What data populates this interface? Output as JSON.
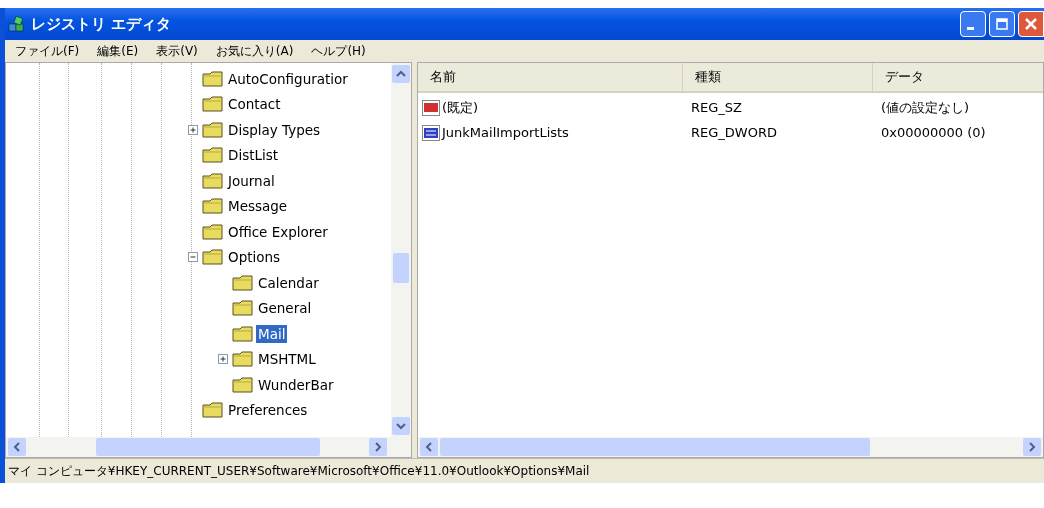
{
  "window": {
    "title": "レジストリ エディタ"
  },
  "menu": [
    {
      "label": "ファイル(F)"
    },
    {
      "label": "編集(E)"
    },
    {
      "label": "表示(V)"
    },
    {
      "label": "お気に入り(A)"
    },
    {
      "label": "ヘルプ(H)"
    }
  ],
  "tree": {
    "items": [
      {
        "label": "AutoConfiguratior",
        "selected": false
      },
      {
        "label": "Contact",
        "selected": false
      },
      {
        "label": "Display Types",
        "selected": false,
        "expanded": false
      },
      {
        "label": "DistList",
        "selected": false
      },
      {
        "label": "Journal",
        "selected": false
      },
      {
        "label": "Message",
        "selected": false
      },
      {
        "label": "Office Explorer",
        "selected": false
      },
      {
        "label": "Options",
        "selected": false,
        "expanded": true,
        "children": [
          {
            "label": "Calendar",
            "selected": false
          },
          {
            "label": "General",
            "selected": false
          },
          {
            "label": "Mail",
            "selected": true
          },
          {
            "label": "MSHTML",
            "selected": false,
            "expanded": false
          },
          {
            "label": "WunderBar",
            "selected": false
          }
        ]
      },
      {
        "label": "Preferences",
        "selected": false
      }
    ]
  },
  "list": {
    "columns": [
      "名前",
      "種類",
      "データ"
    ],
    "rows": [
      {
        "kind": "string",
        "name": "(既定)",
        "type": "REG_SZ",
        "data": "(値の設定なし)"
      },
      {
        "kind": "binary",
        "name": "JunkMailImportLists",
        "type": "REG_DWORD",
        "data": "0x00000000 (0)"
      }
    ]
  },
  "status_bar": "マイ コンピュータ¥HKEY_CURRENT_USER¥Software¥Microsoft¥Office¥11.0¥Outlook¥Options¥Mail"
}
